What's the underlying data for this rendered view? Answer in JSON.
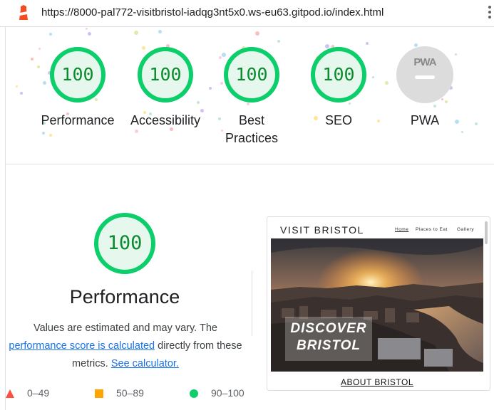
{
  "browser": {
    "url": "https://8000-pal772-visitbristol-iadqg3nt5x0.ws-eu63.gitpod.io/index.html"
  },
  "summary": {
    "gauges": [
      {
        "label": "Performance",
        "score": "100"
      },
      {
        "label": "Accessibility",
        "score": "100"
      },
      {
        "label_line1": "Best",
        "label_line2": "Practices",
        "score": "100"
      },
      {
        "label": "SEO",
        "score": "100"
      }
    ],
    "pwa": {
      "label": "PWA",
      "badge_text": "PWA"
    },
    "colors": {
      "pass": "#0cce6b",
      "pass_text": "#0b8a2e",
      "pass_fill": "#e6f8ee",
      "pwa_grey": "#dcdcdc"
    }
  },
  "performance": {
    "score": "100",
    "title": "Performance",
    "desc_line1": "Values are estimated and may vary. The",
    "desc_link1": "performance score is calculated",
    "desc_mid": " directly from these",
    "desc_line3": "metrics. ",
    "desc_link2": "See calculator."
  },
  "legend": [
    {
      "range": "0–49",
      "color": "#ff4e42",
      "icon": "triangle-icon"
    },
    {
      "range": "50–89",
      "color": "#ffa400",
      "icon": "square-icon"
    },
    {
      "range": "90–100",
      "color": "#0cce6b",
      "icon": "circle-icon"
    }
  ],
  "screenshot": {
    "brand": "VISIT BRISTOL",
    "nav": [
      "Home",
      "Places to Eat",
      "Gallery"
    ],
    "hero_line1": "DISCOVER",
    "hero_line2": "BRISTOL",
    "about": "ABOUT BRISTOL"
  }
}
